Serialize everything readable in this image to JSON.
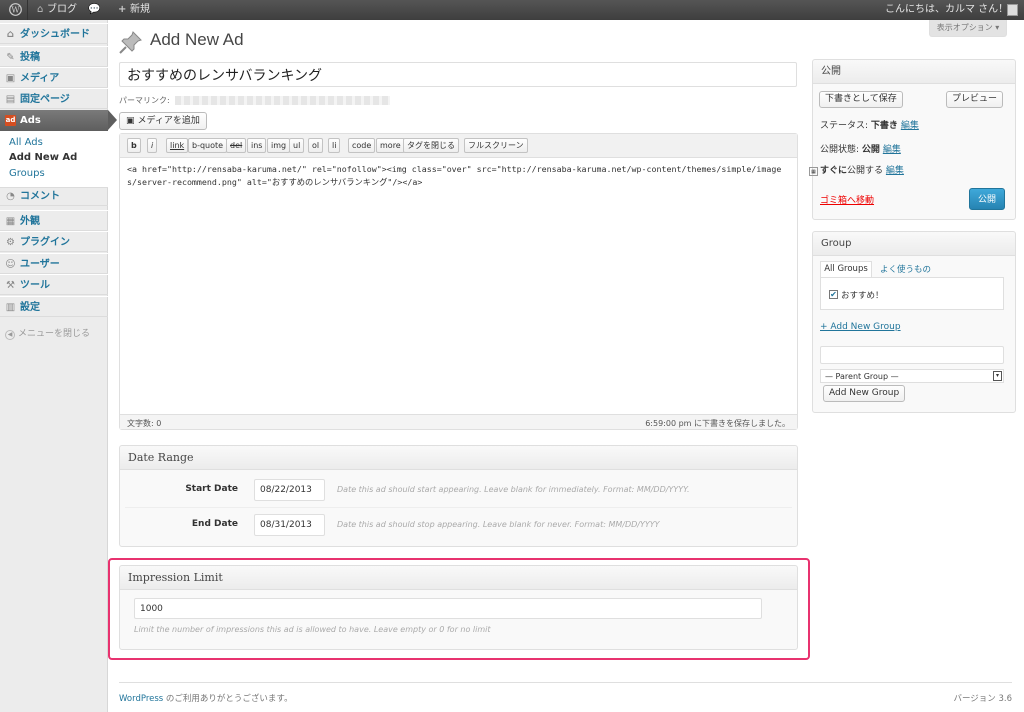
{
  "admin_bar": {
    "blog_label": "ブログ",
    "new_label": "新規",
    "greeting": "こんにちは、カルマ さん！"
  },
  "screen_options": "表示オプション ▾",
  "sidebar": {
    "items": [
      {
        "label": "ダッシュボード",
        "icon": "home-icon"
      },
      {
        "label": "投稿",
        "icon": "pin-icon"
      },
      {
        "label": "メディア",
        "icon": "media-icon"
      },
      {
        "label": "固定ページ",
        "icon": "page-icon"
      },
      {
        "label": "Ads",
        "icon": "ads-icon"
      },
      {
        "label": "コメント",
        "icon": "comment-icon"
      },
      {
        "label": "外観",
        "icon": "appearance-icon"
      },
      {
        "label": "プラグイン",
        "icon": "plugin-icon"
      },
      {
        "label": "ユーザー",
        "icon": "users-icon"
      },
      {
        "label": "ツール",
        "icon": "tools-icon"
      },
      {
        "label": "設定",
        "icon": "settings-icon"
      }
    ],
    "submenu": [
      "All Ads",
      "Add New Ad",
      "Groups"
    ],
    "collapse": "メニューを閉じる"
  },
  "page_title": "Add New Ad",
  "post_title": "おすすめのレンサバランキング",
  "permalink_label": "パーマリンク:",
  "add_media": "メディアを追加",
  "quicktags": [
    "b",
    "i",
    "link",
    "b-quote",
    "del",
    "ins",
    "img",
    "ul",
    "ol",
    "li",
    "code",
    "more",
    "タグを閉じる",
    "フルスクリーン"
  ],
  "editor_content": "<a href=\"http://rensaba-karuma.net/\" rel=\"nofollow\"><img class=\"over\" src=\"http://rensaba-karuma.net/wp-content/themes/simple/images/server-recommend.png\" alt=\"おすすめのレンサバランキング\"/></a>",
  "word_count": "文字数: 0",
  "autosave": "6:59:00 pm に下書きを保存しました。",
  "date_range": {
    "title": "Date Range",
    "start_label": "Start Date",
    "start_value": "08/22/2013",
    "start_help": "Date this ad should start appearing. Leave blank for immediately. Format: MM/DD/YYYY.",
    "end_label": "End Date",
    "end_value": "08/31/2013",
    "end_help": "Date this ad should stop appearing. Leave blank for never. Format: MM/DD/YYYY"
  },
  "impression": {
    "title": "Impression Limit",
    "value": "1000",
    "help": "Limit the number of impressions this ad is allowed to have. Leave empty or 0 for no limit"
  },
  "publish": {
    "title": "公開",
    "save_draft": "下書きとして保存",
    "preview": "プレビュー",
    "status_label": "ステータス:",
    "status_value": "下書き",
    "visibility_label": "公開状態:",
    "visibility_value": "公開",
    "schedule_value": "すぐに",
    "schedule_suffix": "公開する",
    "edit": "編集",
    "trash": "ゴミ箱へ移動",
    "publish_btn": "公開"
  },
  "group": {
    "title": "Group",
    "tab_all": "All Groups",
    "tab_popular": "よく使うもの",
    "item": "おすすめ！",
    "add_link": "+ Add New Group",
    "new_group_value": "",
    "parent_select": "— Parent Group —",
    "add_btn": "Add New Group"
  },
  "footer": {
    "wp": "WordPress",
    "thanks": " のご利用ありがとうございます。",
    "version": "バージョン 3.6"
  },
  "colors": {
    "accent": "#21759b",
    "highlight": "#e8326f",
    "publish": "#2e9fd2"
  }
}
